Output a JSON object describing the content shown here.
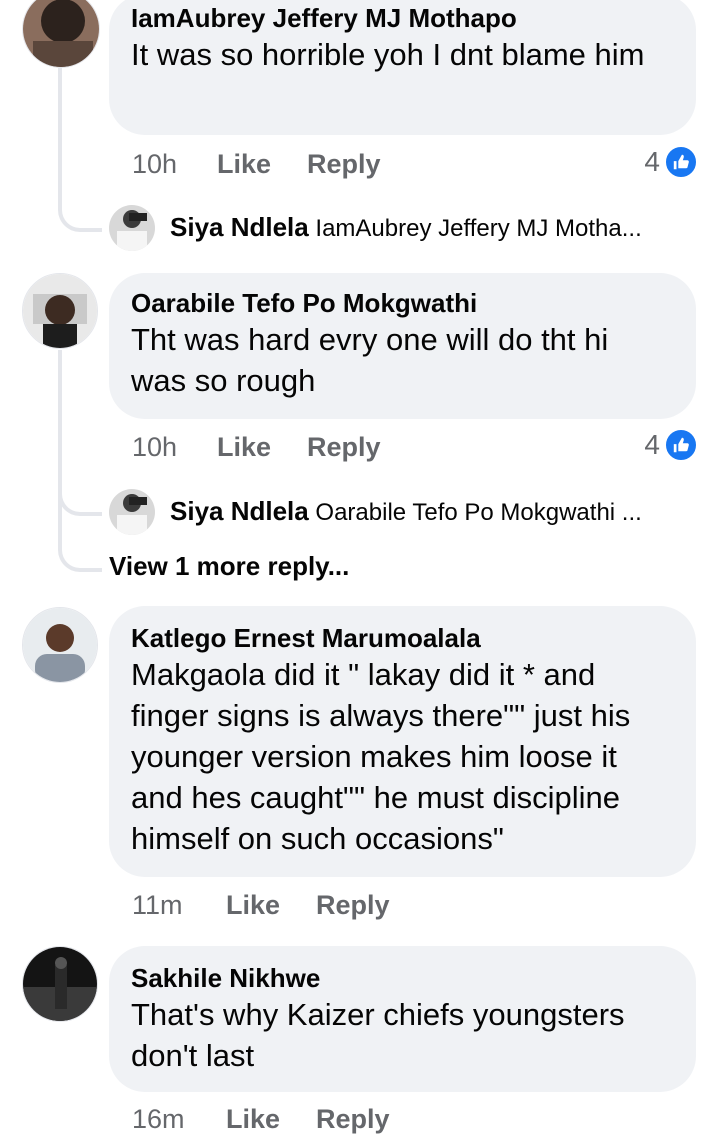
{
  "comments": [
    {
      "author": "IamAubrey Jeffery MJ Mothapo",
      "text": "It was so horrible yoh I dnt blame him",
      "time": "10h",
      "like": "Like",
      "reply": "Reply",
      "likes": "4",
      "reply_preview": {
        "author": "Siya Ndlela",
        "text": "IamAubrey Jeffery MJ Motha..."
      }
    },
    {
      "author": "Oarabile Tefo Po Mokgwathi",
      "text": "Tht was hard evry one will do tht  hi was so rough",
      "time": "10h",
      "like": "Like",
      "reply": "Reply",
      "likes": "4",
      "reply_preview": {
        "author": "Siya Ndlela",
        "text": "Oarabile Tefo Po Mokgwathi ..."
      },
      "view_more": "View 1 more reply..."
    },
    {
      "author": "Katlego Ernest Marumoalala",
      "text": "Makgaola did it \" lakay did it * and finger signs is always there\"\" just his younger version makes him loose it and hes caught\"\" he must discipline himself on such occasions\"",
      "time": "11m",
      "like": "Like",
      "reply": "Reply"
    },
    {
      "author": "Sakhile Nikhwe",
      "text": "That's why Kaizer chiefs youngsters don't last",
      "time": "16m",
      "like": "Like",
      "reply": "Reply"
    }
  ],
  "colors": {
    "bubble": "#f0f2f5",
    "meta": "#65676b",
    "like_blue": "#1877f2"
  }
}
